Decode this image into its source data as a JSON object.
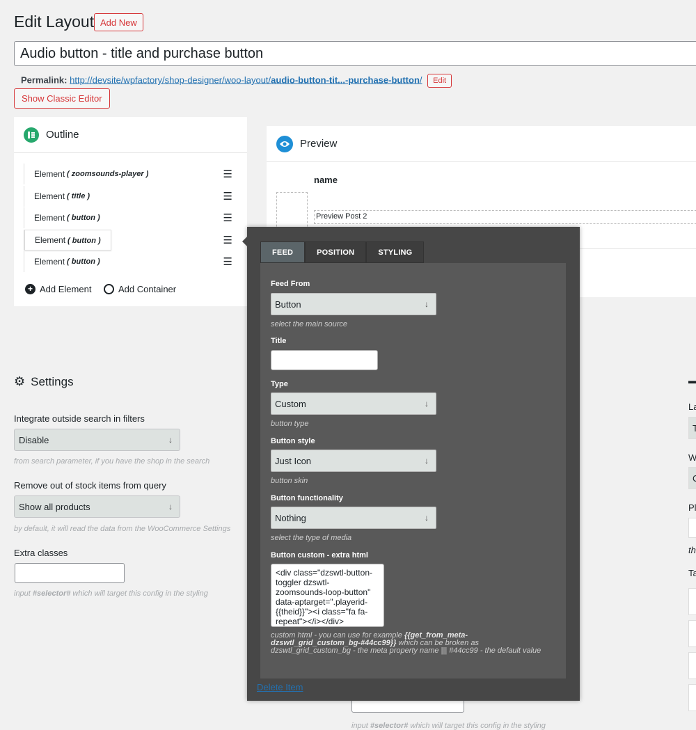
{
  "header": {
    "title": "Edit Layout",
    "add_new": "Add New",
    "post_title": "Audio button - title and purchase button",
    "permalink_label": "Permalink:",
    "permalink_base": "http://devsite/wpfactory/shop-designer/woo-layout/",
    "permalink_slug": "audio-button-tit...-purchase-button",
    "permalink_end": "/",
    "permalink_edit": "Edit",
    "classic_editor": "Show Classic Editor"
  },
  "outline": {
    "title": "Outline",
    "elements": [
      {
        "label": "Element",
        "tag": "( zoomsounds-player )"
      },
      {
        "label": "Element",
        "tag": "( title )"
      },
      {
        "label": "Element",
        "tag": "( button )"
      },
      {
        "label": "Element",
        "tag": "( button )"
      },
      {
        "label": "Element",
        "tag": "( button )"
      }
    ],
    "add_element": "Add Element",
    "add_container": "Add Container"
  },
  "preview": {
    "title": "Preview",
    "column_name": "name",
    "post": "Preview Post 2"
  },
  "settings": {
    "title": "Settings",
    "integrate_label": "Integrate outside search in filters",
    "integrate_value": "Disable",
    "integrate_help": "from search parameter, if you have the shop in the search",
    "remove_label": "Remove out of stock items from query",
    "remove_value": "Show all products",
    "remove_help": "by default, it will read the data from the WooCommerce Settings",
    "extra_label": "Extra classes",
    "extra_help_pre": "input ",
    "extra_help_em": "#selector#",
    "extra_help_post": " which will target this config in the styling"
  },
  "right_column": {
    "l1": "La",
    "l1_value": "T",
    "l2": "W",
    "l2_value": "C",
    "l3": "Pl",
    "l3_help": "th",
    "l4": "Ta"
  },
  "bottom": {
    "help_pre": "input ",
    "help_em": "#selector#",
    "help_post": " which will target this config in the styling"
  },
  "popup": {
    "tabs": [
      "FEED",
      "POSITION",
      "STYLING"
    ],
    "feed_from_label": "Feed From",
    "feed_from_value": "Button",
    "feed_from_help": "select the main source",
    "title_label": "Title",
    "title_value": "",
    "type_label": "Type",
    "type_value": "Custom",
    "type_help": "button type",
    "style_label": "Button style",
    "style_value": "Just Icon",
    "style_help": "button skin",
    "func_label": "Button functionality",
    "func_value": "Nothing",
    "func_help": "select the type of media",
    "custom_label": "Button custom - extra html",
    "custom_value": "<div class=\"dzswtl-button-toggler dzswtl-zoomsounds-loop-button\" data-aptarget=\".playerid-{{theid}}\"><i class=\"fa fa-repeat\"></i></div>",
    "custom_help_pre": "custom html - you can use for example ",
    "custom_help_bold": "{{get_from_meta-dzswtl_grid_custom_bg-#44cc99}}",
    "custom_help_post": " which can be broken as dzswtl_grid_custom_bg - the meta property name ||| #44cc99 - the default value",
    "delete": "Delete Item"
  }
}
